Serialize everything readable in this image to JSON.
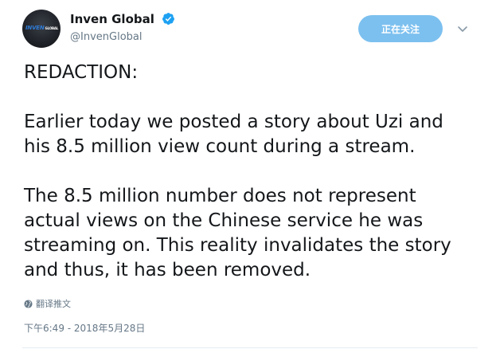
{
  "user": {
    "display_name": "Inven Global",
    "handle": "@InvenGlobal",
    "verified": true,
    "avatar_text": "INVEN",
    "avatar_subtext": "GLOBAL"
  },
  "follow_button": {
    "label": "正在关注"
  },
  "tweet": {
    "paragraphs": [
      "REDACTION:",
      "Earlier today we posted a story about Uzi and\nhis 8.5 million view count during a stream.",
      "The 8.5 million number does not represent\nactual views on the Chinese service he was\nstreaming on. This reality invalidates the story\nand thus, it has been removed."
    ]
  },
  "translate": {
    "label": "翻译推文"
  },
  "timestamp": "下午6:49 - 2018年5月28日",
  "colors": {
    "follow_button_bg": "#7cc0ef",
    "verified_blue": "#1da1f2",
    "secondary_text": "#657786"
  },
  "icons": {
    "verified": "verified-badge-icon",
    "chevron": "chevron-down-icon",
    "globe": "globe-icon"
  }
}
